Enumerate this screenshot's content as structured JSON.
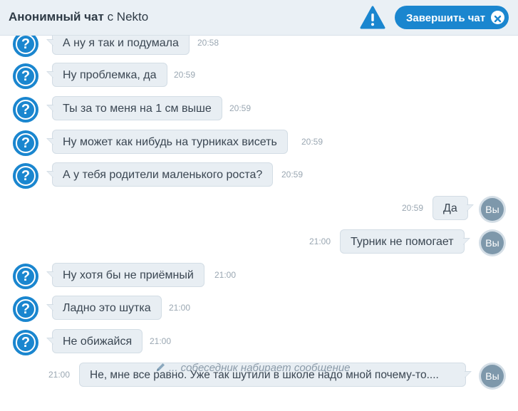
{
  "header": {
    "title_bold": "Анонимный чат",
    "title_rest": " с Nekto",
    "end_button_label": "Завершить чат"
  },
  "colors": {
    "accent": "#1a86cf",
    "bubble": "#e8eef3",
    "header_bg": "#eaf0f5"
  },
  "messages": [
    {
      "from": "stranger",
      "avatar": "?",
      "text": "А ну я так и подумала",
      "time": "20:58"
    },
    {
      "from": "stranger",
      "avatar": "?",
      "text": "Ну проблемка, да",
      "time": "20:59"
    },
    {
      "from": "stranger",
      "avatar": "?",
      "text": "Ты за то меня на 1 см выше",
      "time": "20:59"
    },
    {
      "from": "stranger",
      "avatar": "?",
      "text": "Ну может как нибудь на турниках висеть",
      "time": "20:59"
    },
    {
      "from": "stranger",
      "avatar": "?",
      "text": "А у тебя родители маленького роста?",
      "time": "20:59"
    },
    {
      "from": "you",
      "avatar": "Вы",
      "text": "Да",
      "time": "20:59"
    },
    {
      "from": "you",
      "avatar": "Вы",
      "text": "Турник не помогает",
      "time": "21:00"
    },
    {
      "from": "stranger",
      "avatar": "?",
      "text": "Ну хотя бы не приёмный",
      "time": "21:00"
    },
    {
      "from": "stranger",
      "avatar": "?",
      "text": "Ладно это шутка",
      "time": "21:00"
    },
    {
      "from": "stranger",
      "avatar": "?",
      "text": "Не обижайся",
      "time": "21:00"
    },
    {
      "from": "you",
      "avatar": "Вы",
      "text": "Не, мне все равно. Уже так шутили в школе надо мной почему-то....",
      "time": "21:00"
    }
  ],
  "typing_indicator": "... собеседник набирает сообщение"
}
